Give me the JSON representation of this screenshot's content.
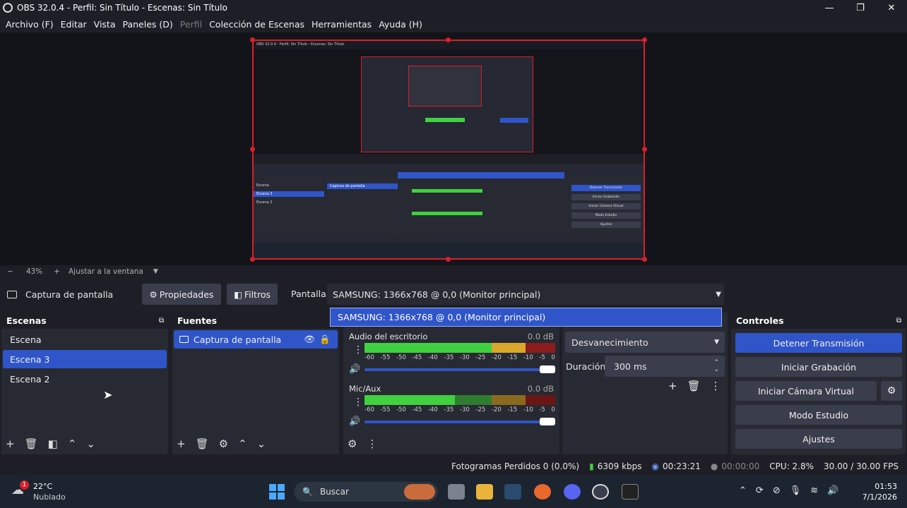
{
  "window": {
    "title": "OBS 32.0.4 - Perfil: Sin Título - Escenas: Sin Título",
    "minimize": "—",
    "maximize": "❐",
    "close": "✕"
  },
  "menu": [
    "Archivo (F)",
    "Editar",
    "Vista",
    "Paneles (D)",
    "Perfil",
    "Colección de Escenas",
    "Herramientas",
    "Ayuda (H)"
  ],
  "zoom": {
    "minus": "−",
    "value": "43%",
    "plus": "+",
    "fit": "Ajustar a la ventana"
  },
  "source_bar": {
    "name": "Captura de pantalla",
    "properties": "Propiedades",
    "filters": "Filtros",
    "display_label": "Pantalla",
    "display_value": "SAMSUNG: 1366x768 @ 0,0 (Monitor principal)",
    "dropdown_option": "SAMSUNG: 1366x768 @ 0,0 (Monitor principal)"
  },
  "scenes": {
    "title": "Escenas",
    "items": [
      "Escena",
      "Escena 3",
      "Escena 2"
    ],
    "selected": 1
  },
  "sources": {
    "title": "Fuentes",
    "items": [
      "Captura de pantalla"
    ]
  },
  "mixer": {
    "channels": [
      {
        "name": "Audio del escritorio",
        "db": "0.0 dB"
      },
      {
        "name": "Mic/Aux",
        "db": "0.0 dB"
      }
    ],
    "ticks": [
      "-60",
      "-55",
      "-50",
      "-45",
      "-40",
      "-35",
      "-30",
      "-25",
      "-20",
      "-15",
      "-10",
      "-5",
      "0"
    ]
  },
  "transitions": {
    "type": "Desvanecimiento",
    "duration_label": "Duración",
    "duration": "300 ms"
  },
  "controls": {
    "title": "Controles",
    "stop_stream": "Detener Transmisión",
    "start_record": "Iniciar Grabación",
    "virtual_cam": "Iniciar Cámara Virtual",
    "studio": "Modo Estudio",
    "settings": "Ajustes"
  },
  "status": {
    "dropped": "Fotogramas Perdidos 0 (0.0%)",
    "bitrate": "6309 kbps",
    "stream_time": "00:23:21",
    "record_time": "00:00:00",
    "cpu": "CPU: 2.8%",
    "fps": "30.00 / 30.00 FPS"
  },
  "taskbar": {
    "temp": "22°C",
    "weather": "Nublado",
    "badge": "1",
    "search": "Buscar",
    "time": "01:53",
    "date": "7/1/2026"
  },
  "preview": {
    "mini_title": "OBS 32.0.4 - Perfil: Sin Título - Escenas: Sin Título",
    "mini_scene_items": [
      "Escena",
      "Escena 3",
      "Escena 2"
    ],
    "mini_source": "Captura de pantalla",
    "mini_controls": [
      "Detener Transmisión",
      "Iniciar Grabación",
      "Iniciar Cámara Virtual",
      "Modo Estudio",
      "Ajustes"
    ]
  },
  "colors": {
    "accent": "#2f55c9",
    "red": "#d9202a",
    "panel": "#272a33",
    "meter_green": "#3fd13f",
    "meter_yellow": "#d9a72b",
    "meter_red": "#8a1c1c"
  }
}
